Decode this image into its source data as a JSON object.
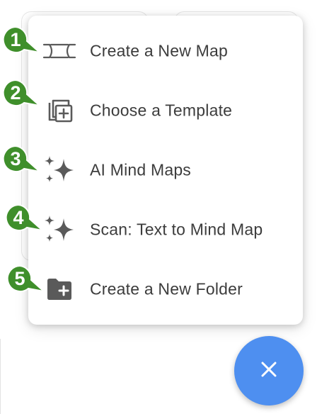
{
  "menu": {
    "items": [
      {
        "label": "Create a New Map",
        "icon": "new-map-icon",
        "badge": "1"
      },
      {
        "label": "Choose a Template",
        "icon": "template-copy-icon",
        "badge": "2"
      },
      {
        "label": "AI Mind Maps",
        "icon": "sparkle-icon",
        "badge": "3"
      },
      {
        "label": "Scan: Text to Mind Map",
        "icon": "sparkle-icon",
        "badge": "4"
      },
      {
        "label": "Create a New Folder",
        "icon": "folder-plus-icon",
        "badge": "5"
      }
    ]
  },
  "fab": {
    "icon": "close-icon"
  },
  "colors": {
    "fab": "#4e8ff0",
    "badge": "#3f8f2b",
    "badge_border": "#ffffff",
    "icon": "#5a5a5a",
    "text": "#3c3c3c"
  }
}
